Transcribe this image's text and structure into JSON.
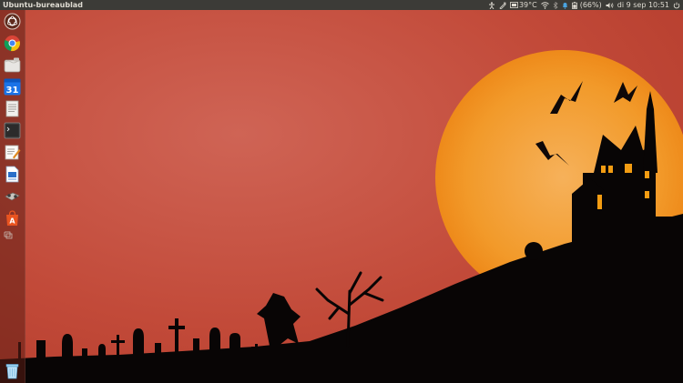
{
  "panel": {
    "app_title": "Ubuntu-bureaublad",
    "temperature": "39°C",
    "battery_percent": "(66%)",
    "datetime": "di 9 sep 10:51"
  },
  "launcher": {
    "items": [
      {
        "name": "dash-home-icon"
      },
      {
        "name": "chromium-browser-icon"
      },
      {
        "name": "file-manager-icon"
      },
      {
        "name": "calendar-icon",
        "text": "31"
      },
      {
        "name": "text-document-icon"
      },
      {
        "name": "terminal-icon"
      },
      {
        "name": "text-editor-icon"
      },
      {
        "name": "writer-icon"
      },
      {
        "name": "utilities-icon"
      },
      {
        "name": "software-center-icon"
      },
      {
        "name": "workspace-switcher-icon"
      },
      {
        "name": "trash-icon"
      }
    ]
  },
  "colors": {
    "panel_bg": "#3c3b37",
    "panel_text": "#dfdbd2",
    "wallpaper_red": "#c0392b",
    "moon_orange": "#f39c12"
  }
}
